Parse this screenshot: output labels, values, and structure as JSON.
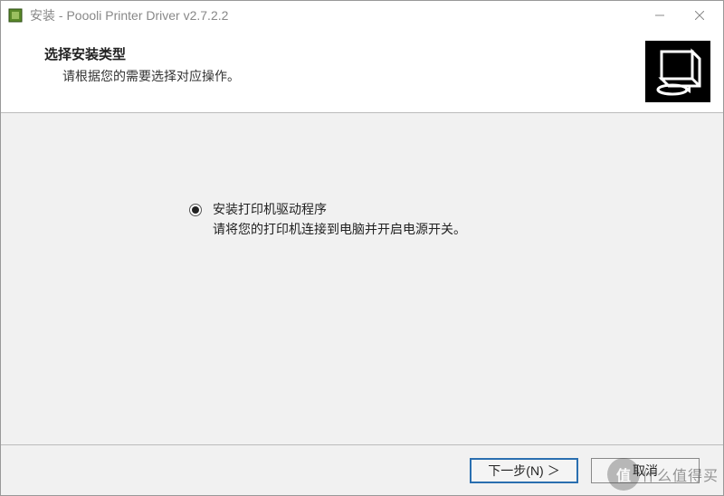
{
  "window": {
    "title": "安装 - Poooli Printer Driver v2.7.2.2"
  },
  "header": {
    "heading": "选择安装类型",
    "subheading": "请根据您的需要选择对应操作。"
  },
  "options": {
    "install": {
      "selected": true,
      "title": "安装打印机驱动程序",
      "description": "请将您的打印机连接到电脑并开启电源开关。"
    }
  },
  "footer": {
    "next_label": "下一步(N)",
    "next_arrow": "＞",
    "cancel_label": "取消"
  },
  "watermark": {
    "badge": "值",
    "text": "什么值得买"
  }
}
